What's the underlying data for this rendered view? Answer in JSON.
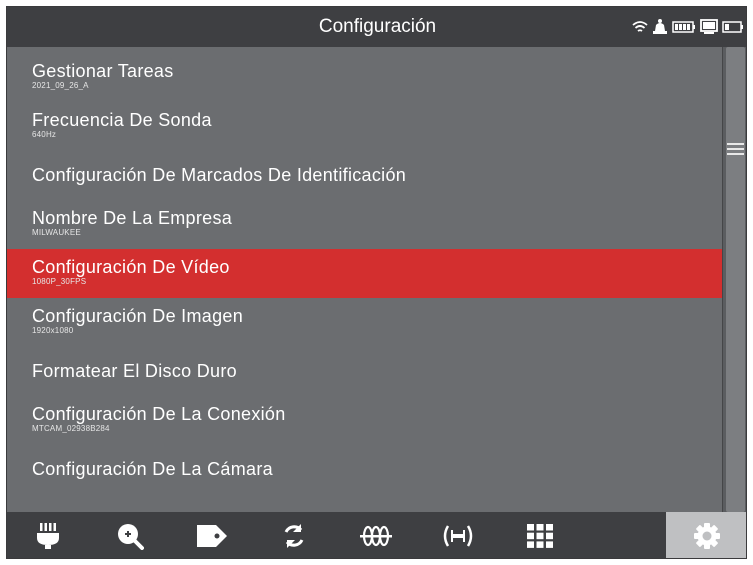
{
  "header": {
    "title": "Configuración",
    "status_icons": [
      "wifi-icon",
      "bell-icon",
      "battery-icon",
      "monitor-icon",
      "battery-small-icon"
    ]
  },
  "menu": {
    "items": [
      {
        "label": "Gestionar Tareas",
        "sub": "2021_09_26_A"
      },
      {
        "label": "Frecuencia De Sonda",
        "sub": "640Hz"
      },
      {
        "label": "Configuración De Marcados De Identificación",
        "sub": ""
      },
      {
        "label": "Nombre De La Empresa",
        "sub": "MILWAUKEE"
      },
      {
        "label": "Configuración De Vídeo",
        "sub": "1080P_30FPS"
      },
      {
        "label": "Configuración De Imagen",
        "sub": "1920x1080"
      },
      {
        "label": "Formatear El Disco Duro",
        "sub": ""
      },
      {
        "label": "Configuración De La Conexión",
        "sub": "MTCAM_02938B284"
      },
      {
        "label": "Configuración De La Cámara",
        "sub": ""
      }
    ],
    "selected_index": 4
  },
  "toolbar": {
    "tools": [
      "light-icon",
      "zoom-in-icon",
      "tag-icon",
      "rotate-icon",
      "sonde-icon",
      "locator-icon",
      "grid-icon",
      "settings-icon"
    ],
    "active_tool": "settings-icon"
  },
  "colors": {
    "background": "#6b6d70",
    "header": "#3e3f42",
    "selected": "#d32f2f",
    "active_tool": "#bfc0c2"
  }
}
